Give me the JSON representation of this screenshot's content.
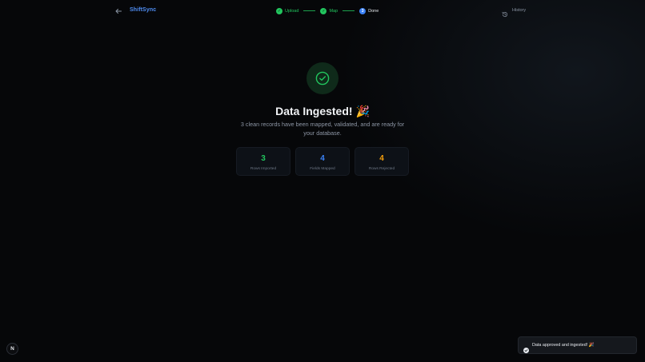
{
  "header": {
    "brand": "ShiftSync",
    "history_label": "History",
    "steps": [
      {
        "label": "Upload",
        "state": "done",
        "marker": "✓"
      },
      {
        "label": "Map",
        "state": "done",
        "marker": "✓"
      },
      {
        "label": "Done",
        "state": "current",
        "marker": "3"
      }
    ]
  },
  "main": {
    "title": "Data Ingested! 🎉",
    "subtitle": "3 clean records have been mapped, validated, and are ready for your database.",
    "stats": [
      {
        "value": "3",
        "label": "Rows Imported",
        "color": "#22c55e"
      },
      {
        "value": "4",
        "label": "Fields Mapped",
        "color": "#3b82f6"
      },
      {
        "value": "4",
        "label": "Rows Rejected",
        "color": "#f59e0b"
      }
    ]
  },
  "footer": {
    "logo_letter": "N"
  },
  "toast": {
    "message": "Data approved and ingested! 🎉"
  },
  "icons": {
    "back": "arrow-left-icon",
    "history": "history-icon",
    "success": "check-circle-icon",
    "toast": "check-circle-icon"
  },
  "colors": {
    "brand": "#4f8df2",
    "success": "#22c55e",
    "info": "#3b82f6",
    "warning": "#f59e0b",
    "background": "#060709"
  }
}
